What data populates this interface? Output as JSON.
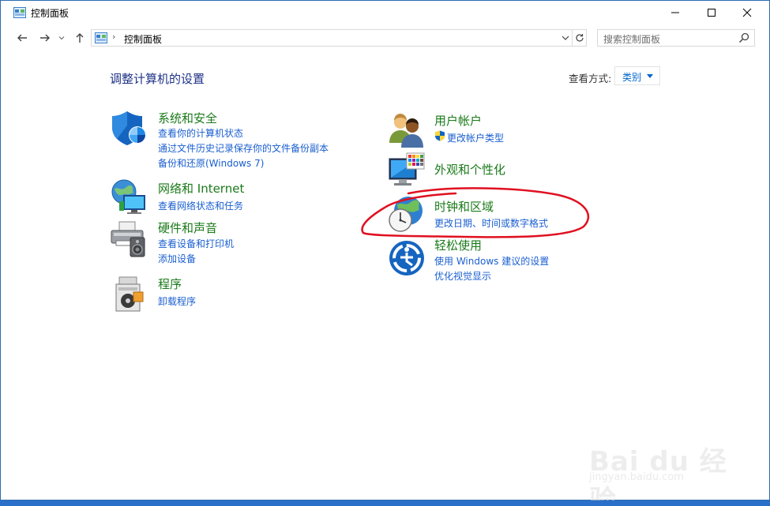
{
  "window": {
    "title": "控制面板"
  },
  "address": {
    "path": "控制面板",
    "separator": "›"
  },
  "search": {
    "placeholder": "搜索控制面板"
  },
  "main": {
    "heading": "调整计算机的设置",
    "view_by_label": "查看方式:",
    "view_by_value": "类别"
  },
  "categories": [
    {
      "title": "系统和安全",
      "links": [
        "查看你的计算机状态",
        "通过文件历史记录保存你的文件备份副本",
        "备份和还原(Windows 7)"
      ],
      "icon": "shield-icon"
    },
    {
      "title": "网络和 Internet",
      "links": [
        "查看网络状态和任务"
      ],
      "icon": "network-globe-icon"
    },
    {
      "title": "硬件和声音",
      "links": [
        "查看设备和打印机",
        "添加设备"
      ],
      "icon": "printer-speaker-icon"
    },
    {
      "title": "程序",
      "links": [
        "卸载程序"
      ],
      "icon": "programs-icon"
    },
    {
      "title": "用户帐户",
      "links": [
        "更改帐户类型"
      ],
      "icon": "users-icon"
    },
    {
      "title": "外观和个性化",
      "links": [],
      "icon": "monitor-palette-icon"
    },
    {
      "title": "时钟和区域",
      "links": [
        "更改日期、时间或数字格式"
      ],
      "icon": "clock-globe-icon"
    },
    {
      "title": "轻松使用",
      "links": [
        "使用 Windows 建议的设置",
        "优化视觉显示"
      ],
      "icon": "ease-of-access-icon"
    }
  ],
  "watermark": {
    "text": "Bai du 经验",
    "sub": "jingyan.baidu.com"
  },
  "colors": {
    "category_title": "#1a7a1a",
    "link": "#1a5fd0",
    "heading": "#1e3287",
    "highlight": "#e01020"
  }
}
